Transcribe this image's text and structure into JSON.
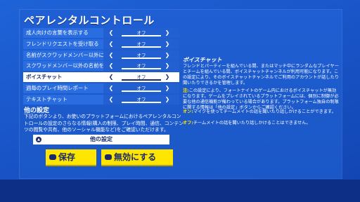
{
  "title": "ペアレンタルコントロール",
  "rows": [
    {
      "label": "成人向けの言葉を表示する",
      "value": "オフ"
    },
    {
      "label": "フレンドリクエストを受け取る",
      "value": "オフ"
    },
    {
      "label": "名前がスクワッドメンバー以外に表示",
      "value": "オフ"
    },
    {
      "label": "スクワッドメンバー以外の名前を表示",
      "value": "オフ"
    },
    {
      "label": "ボイスチャット",
      "value": "オフ"
    },
    {
      "label": "週毎のプレイ時間レポート",
      "value": "オフ"
    },
    {
      "label": "テキストチャット",
      "value": "オフ"
    }
  ],
  "selected_index": 4,
  "other": {
    "title": "他の設定",
    "body": "下記のボタンより、お使いのプラットフォームにおけるペアレンタルコントロールの設定のさらなる情報(購入の制限、プレイ時間、通信、コンテンツの閲覧や共有、他のソーシャル機能など)をご確認いただけます。",
    "button": "他の設定"
  },
  "actions": {
    "save": "保存",
    "disable": "無効にする"
  },
  "info": {
    "title": "ボイスチャット",
    "desc": "フレンドとパーティーを組んでいる間、またはマッチ中にランダムなプレイヤーとチームを組んでいる間、ボイスチャットチャンネルが利用可能になります。この設定により、そのボイスチャットチャンネルでご利用のアカウントが話したり聞いたりできるかを管理します。",
    "options": [
      {
        "key": "注:",
        "text": "この設定により、フォートナイトのゲーム内におけるボイスチャットが無効になります。ゲームをプレイされているプラットフォームには、個別に制御が必要な他の通信機能が備わっている場合があります。プラットフォーム独自の制限に関する情報は「他の設定」ボタンからご確認ください。"
      },
      {
        "key": "オン:",
        "text": "マイクを使ってチームメイトの話を聞いたり話しかけることができます。"
      },
      {
        "key": "オフ:",
        "text": "チームメイトの話を聞いたり話しかけることはできません。"
      }
    ]
  }
}
